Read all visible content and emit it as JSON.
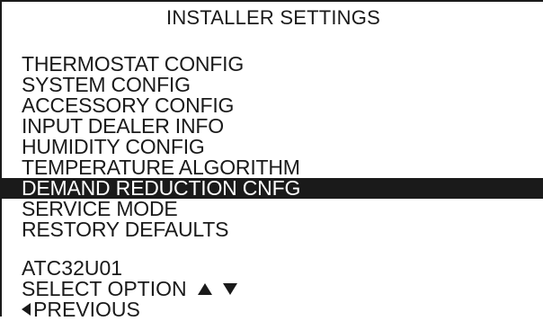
{
  "header": {
    "title": "INSTALLER SETTINGS"
  },
  "menu": {
    "items": [
      {
        "label": "THERMOSTAT CONFIG"
      },
      {
        "label": "SYSTEM CONFIG"
      },
      {
        "label": "ACCESSORY CONFIG"
      },
      {
        "label": "INPUT DEALER INFO"
      },
      {
        "label": "HUMIDITY CONFIG"
      },
      {
        "label": "TEMPERATURE ALGORITHM"
      },
      {
        "label": "DEMAND REDUCTION CNFG"
      },
      {
        "label": "SERVICE MODE"
      },
      {
        "label": "RESTORY DEFAULTS"
      }
    ],
    "selected_index": 6
  },
  "footer": {
    "model_code": "ATC32U01",
    "select_prompt": "SELECT OPTION",
    "previous_label": "PREVIOUS",
    "icons": [
      "up-arrow-icon",
      "down-arrow-icon",
      "left-arrow-icon"
    ]
  }
}
